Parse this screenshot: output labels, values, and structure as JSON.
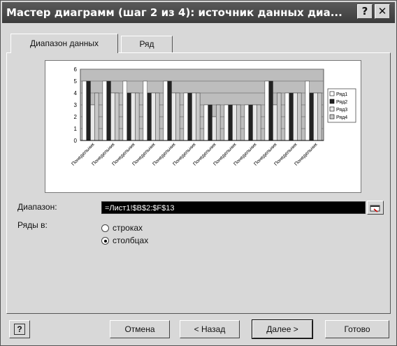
{
  "window": {
    "title": "Мастер диаграмм (шаг 2 из 4): источник данных диа...",
    "help_glyph": "?",
    "close_glyph": "✕"
  },
  "tabs": [
    {
      "label": "Диапазон данных",
      "active": true
    },
    {
      "label": "Ряд",
      "active": false
    }
  ],
  "chart_data": {
    "type": "bar",
    "categories": [
      "Понедельник",
      "Понедельник",
      "Понедельник",
      "Понедельник",
      "Понедельник",
      "Понедельник",
      "Понедельник",
      "Понедельник",
      "Понедельник",
      "Понедельник",
      "Понедельник",
      "Понедельник"
    ],
    "series": [
      {
        "name": "Ряд1",
        "values": [
          5,
          5,
          5,
          5,
          5,
          4,
          3,
          3,
          3,
          5,
          4,
          5
        ]
      },
      {
        "name": "Ряд2",
        "values": [
          5,
          5,
          4,
          4,
          5,
          4,
          3,
          3,
          3,
          5,
          4,
          4
        ]
      },
      {
        "name": "Ряд3",
        "values": [
          3,
          4,
          4,
          4,
          4,
          4,
          2,
          3,
          3,
          3,
          4,
          4
        ]
      },
      {
        "name": "Ряд4",
        "values": [
          4,
          4,
          4,
          4,
          4,
          4,
          3,
          3,
          3,
          4,
          4,
          4
        ]
      }
    ],
    "yticks": [
      "0",
      "1",
      "2",
      "3",
      "4",
      "5",
      "6"
    ],
    "ylim": [
      0,
      6
    ],
    "colors": [
      "#ffffff",
      "#222222",
      "#e8e8e8",
      "#c8c8c8"
    ],
    "legend_position": "right",
    "grid": true
  },
  "range": {
    "label": "Диапазон:",
    "value": "=Лист1!$B$2:$F$13"
  },
  "series_in": {
    "label": "Ряды в:",
    "options": [
      {
        "label": "строках",
        "selected": false
      },
      {
        "label": "столбцах",
        "selected": true
      }
    ]
  },
  "buttons": {
    "help": "?",
    "cancel": "Отмена",
    "back": "< Назад",
    "next": "Далее >",
    "finish": "Готово"
  }
}
